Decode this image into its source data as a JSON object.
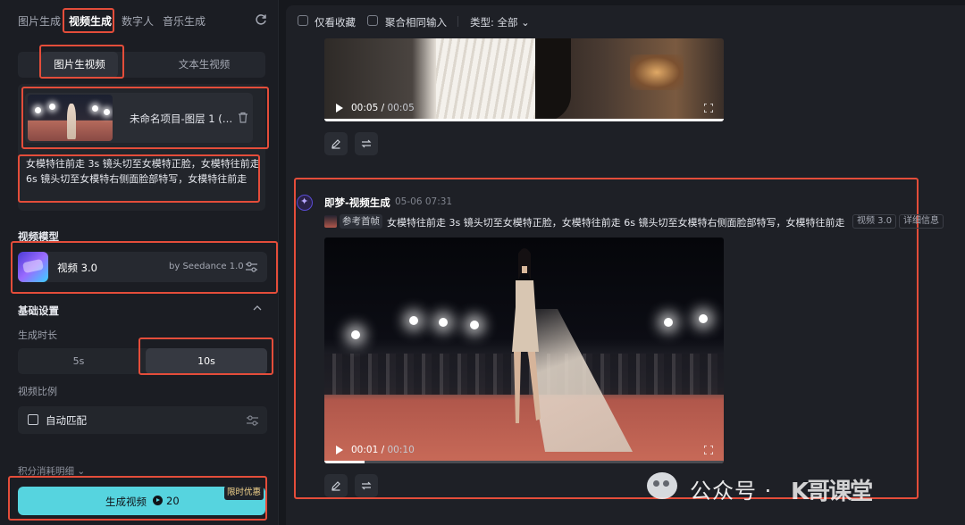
{
  "left_panel": {
    "top_tabs": [
      "图片生成",
      "视频生成",
      "数字人",
      "音乐生成"
    ],
    "active_top_tab": "视频生成",
    "mode_tabs": [
      "图片生视频",
      "文本生视频"
    ],
    "active_mode": "图片生视频",
    "upload": {
      "name": "未命名项目-图层 1 (…",
      "prompt": "女模特往前走 3s 镜头切至女模特正脸，女模特往前走 6s 镜头切至女模特右侧面脸部特写，女模特往前走"
    },
    "model_section_title": "视频模型",
    "model": {
      "name": "视频 3.0",
      "by": "by Seedance 1.0"
    },
    "basic_settings_title": "基础设置",
    "duration_label": "生成时长",
    "duration_options": [
      "5s",
      "10s"
    ],
    "active_duration": "10s",
    "ratio_label": "视频比例",
    "ratio_value": "自动匹配",
    "credits_label": "积分消耗明细",
    "generate": {
      "label": "生成视频",
      "cost": "20",
      "promo": "限时优惠"
    }
  },
  "filter_bar": {
    "favorites_label": "仅看收藏",
    "aggregate_label": "聚合相同输入",
    "type_label": "类型: 全部"
  },
  "video1": {
    "current": "00:05",
    "duration": "00:05",
    "progress": 1.0
  },
  "message": {
    "title": "即梦-视频生成",
    "date": "05-06  07:31",
    "ref_tag": "参考首帧",
    "prompt": "女模特往前走 3s 镜头切至女模特正脸，女模特往前走 6s 镜头切至女模特右侧面脸部特写，女模特往前走",
    "model_tag": "视频 3.0",
    "detail_tag": "详细信息"
  },
  "video2": {
    "current": "00:01",
    "duration": "00:10",
    "progress": 0.1
  },
  "watermark": {
    "text": "公众号 ·",
    "brand": "K哥课堂"
  },
  "colors": {
    "highlight_box": "#e44d3a",
    "generate_button": "#56d4df",
    "promo": "#f1d18a"
  }
}
